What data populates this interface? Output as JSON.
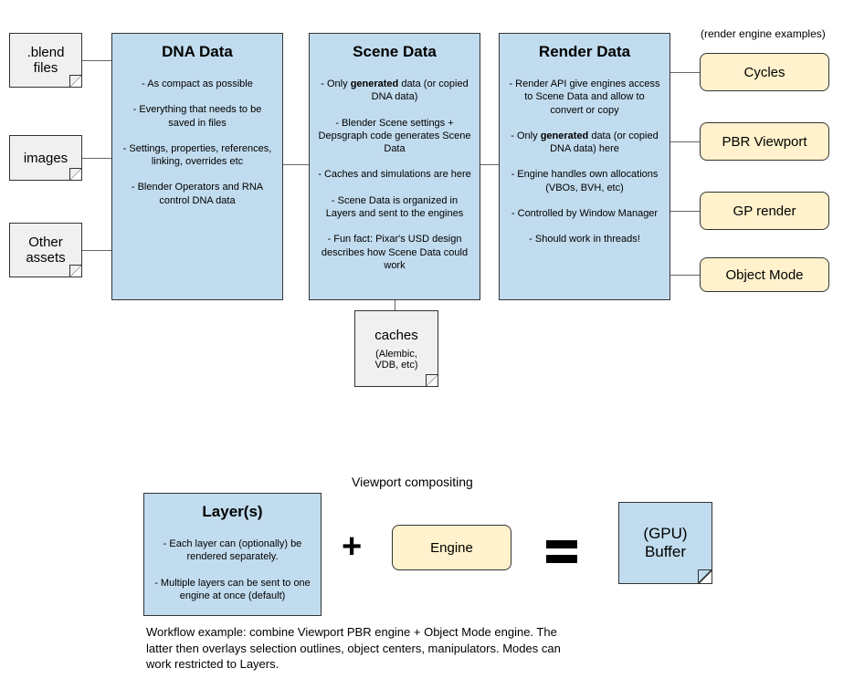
{
  "top_row": {
    "file_boxes": [
      {
        "title": ".blend files"
      },
      {
        "title": "images"
      },
      {
        "title": "Other assets"
      }
    ],
    "dna": {
      "title": "DNA Data",
      "items": [
        "- As compact as possible",
        "- Everything that needs to be saved in files",
        "- Settings, properties, references, linking, overrides etc",
        "- Blender Operators and RNA control DNA data"
      ]
    },
    "scene": {
      "title": "Scene Data",
      "items_html": [
        "- Only <b>generated</b> data (or copied DNA data)",
        "- Blender Scene settings + Depsgraph code generates Scene Data",
        "- Caches and simulations are here",
        "- Scene Data is organized in Layers and sent to the engines",
        "- Fun fact: Pixar's USD design describes how Scene Data could work"
      ]
    },
    "render": {
      "title": "Render Data",
      "items_html": [
        "- Render API give engines access to Scene Data and allow to convert or copy",
        "- Only <b>generated</b> data (or copied DNA data) here",
        "- Engine handles own allocations (VBOs, BVH, etc)",
        "- Controlled by Window Manager",
        "- Should work in threads!"
      ]
    },
    "caches": {
      "title": "caches",
      "subtitle": "(Alembic, VDB, etc)"
    },
    "engine_examples_label": "(render engine examples)",
    "engines": [
      "Cycles",
      "PBR Viewport",
      "GP render",
      "Object Mode"
    ]
  },
  "bottom": {
    "section_title": "Viewport compositing",
    "layers": {
      "title": "Layer(s)",
      "items": [
        "- Each layer can (optionally) be rendered separately.",
        "- Multiple layers can be sent to one engine at once (default)"
      ]
    },
    "engine_label": "Engine",
    "gpu_buffer": "(GPU) Buffer",
    "workflow_text": "Workflow example: combine Viewport PBR engine + Object Mode engine. The latter then overlays selection outlines, object centers, manipulators. Modes can work restricted to Layers."
  }
}
